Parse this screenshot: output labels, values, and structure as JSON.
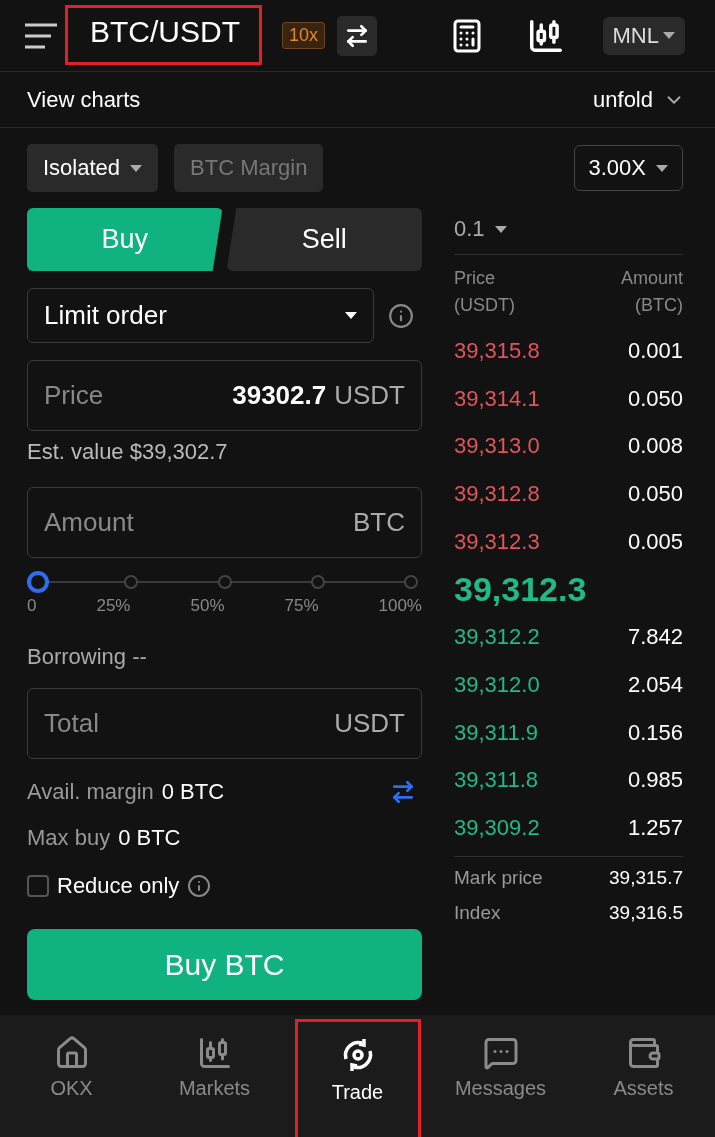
{
  "header": {
    "pair": "BTC/USDT",
    "pair_highlighted": true,
    "leverage_badge": "10x",
    "region": "MNL"
  },
  "chart_bar": {
    "label": "View charts",
    "toggle": "unfold"
  },
  "margin_mode": {
    "mode": "Isolated",
    "currency": "BTC Margin",
    "currency_disabled": true,
    "multiplier": "3.00X"
  },
  "side_tabs": [
    {
      "label": "Buy",
      "selected": true
    },
    {
      "label": "Sell",
      "selected": false
    }
  ],
  "order_type": "Limit order",
  "price_field": {
    "placeholder": "Price",
    "value": "39302.7",
    "unit": "USDT"
  },
  "est_value": "Est. value $39,302.7",
  "amount_field": {
    "placeholder": "Amount",
    "unit": "BTC"
  },
  "amount_slider": {
    "level": 0,
    "stops": [
      "0",
      "25%",
      "50%",
      "75%",
      "100%"
    ]
  },
  "borrowing": "Borrowing --",
  "total_field": {
    "placeholder": "Total",
    "unit": "USDT"
  },
  "avail_margin": {
    "label": "Avail. margin",
    "value": "0 BTC"
  },
  "max_buy": {
    "label": "Max buy",
    "value": "0 BTC"
  },
  "reduce_only": {
    "label": "Reduce only",
    "checked": false
  },
  "submit_button": "Buy BTC",
  "order_book": {
    "precision": "0.1",
    "columns": [
      "Price\n(USDT)",
      "Amount\n(BTC)"
    ],
    "asks": [
      {
        "price": "39,315.8",
        "amount": "0.001"
      },
      {
        "price": "39,314.1",
        "amount": "0.050"
      },
      {
        "price": "39,313.0",
        "amount": "0.008"
      },
      {
        "price": "39,312.8",
        "amount": "0.050"
      },
      {
        "price": "39,312.3",
        "amount": "0.005"
      }
    ],
    "last_price": "39,312.3",
    "bids": [
      {
        "price": "39,312.2",
        "amount": "7.842"
      },
      {
        "price": "39,312.0",
        "amount": "2.054"
      },
      {
        "price": "39,311.9",
        "amount": "0.156"
      },
      {
        "price": "39,311.8",
        "amount": "0.985"
      },
      {
        "price": "39,309.2",
        "amount": "1.257"
      }
    ],
    "stats": [
      {
        "label": "Mark price",
        "value": "39,315.7"
      },
      {
        "label": "Index",
        "value": "39,316.5"
      }
    ]
  },
  "nav": [
    {
      "label": "OKX",
      "kind": "home",
      "selected": false,
      "highlighted": false
    },
    {
      "label": "Markets",
      "kind": "markets",
      "selected": false,
      "highlighted": false
    },
    {
      "label": "Trade",
      "kind": "trade",
      "selected": true,
      "highlighted": true
    },
    {
      "label": "Messages",
      "kind": "messages",
      "selected": false,
      "highlighted": false
    },
    {
      "label": "Assets",
      "kind": "assets",
      "selected": false,
      "highlighted": false
    }
  ]
}
